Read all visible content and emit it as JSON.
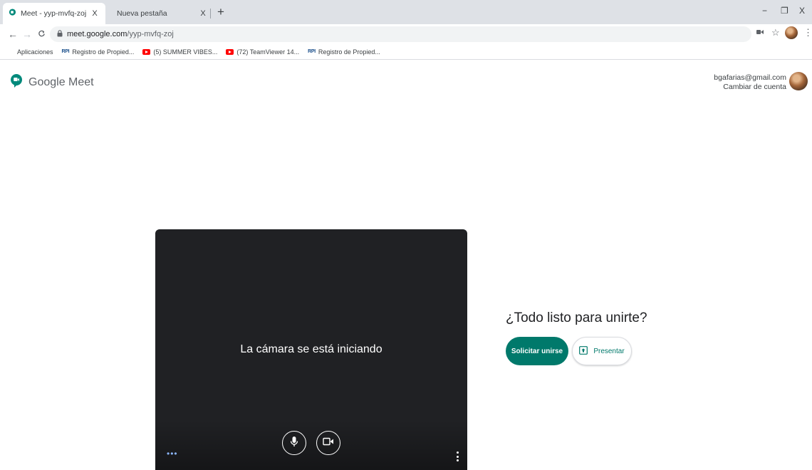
{
  "browser": {
    "tabs": [
      {
        "title": "Meet - yyp-mvfq-zoj",
        "close": "X"
      },
      {
        "title": "Nueva pestaña",
        "close": "X"
      }
    ],
    "new_tab": "+",
    "window_controls": {
      "minimize": "−",
      "restore": "❐",
      "close": "X"
    },
    "url_host": "meet.google.com",
    "url_path": "/yyp-mvfq-zoj",
    "bookmarks": [
      {
        "label": "Aplicaciones",
        "icon": "apps-grid-icon"
      },
      {
        "label": "Registro de Propied...",
        "icon": "rpi-icon"
      },
      {
        "label": "(5) SUMMER VIBES...",
        "icon": "youtube-icon"
      },
      {
        "label": "(72) TeamViewer 14...",
        "icon": "youtube-icon"
      },
      {
        "label": "Registro de Propied...",
        "icon": "rpi-icon"
      }
    ]
  },
  "meet": {
    "brand": "Google Meet",
    "account_email": "bgafarias@gmail.com",
    "switch_account": "Cambiar de cuenta",
    "camera_message": "La cámara se está iniciando",
    "ready_title": "¿Todo listo para unirte?",
    "join_label": "Solicitar unirse",
    "present_label": "Presentar",
    "colors": {
      "accent": "#00796b",
      "preview_bg": "#202124"
    }
  }
}
